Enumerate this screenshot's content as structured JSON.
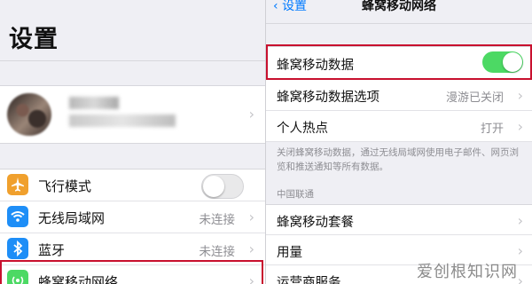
{
  "left": {
    "title": "设置",
    "rows": [
      {
        "icon": "airplane-icon",
        "label": "飞行模式",
        "color": "#f0a02d",
        "switch": "off"
      },
      {
        "icon": "wifi-icon",
        "label": "无线局域网",
        "value": "未连接",
        "color": "#1e8ef7"
      },
      {
        "icon": "bluetooth-icon",
        "label": "蓝牙",
        "value": "未连接",
        "color": "#1e8ef7"
      },
      {
        "icon": "cellular-icon",
        "label": "蜂窝移动网络",
        "color": "#4cd964"
      }
    ]
  },
  "right": {
    "nav": {
      "back": "设置",
      "title": "蜂窝移动网络"
    },
    "rows": [
      {
        "label": "蜂窝移动数据",
        "switch": "on"
      },
      {
        "label": "蜂窝移动数据选项",
        "value": "漫游已关闭"
      },
      {
        "label": "个人热点",
        "value": "打开"
      }
    ],
    "description": "关闭蜂窝移动数据，通过无线局域网使用电子邮件、网页浏览和推送通知等所有数据。",
    "carrier_header": "中国联通",
    "carrier_rows": [
      {
        "label": "蜂窝移动套餐"
      },
      {
        "label": "用量"
      },
      {
        "label": "运营商服务"
      }
    ]
  },
  "watermark": "爱创根知识网"
}
